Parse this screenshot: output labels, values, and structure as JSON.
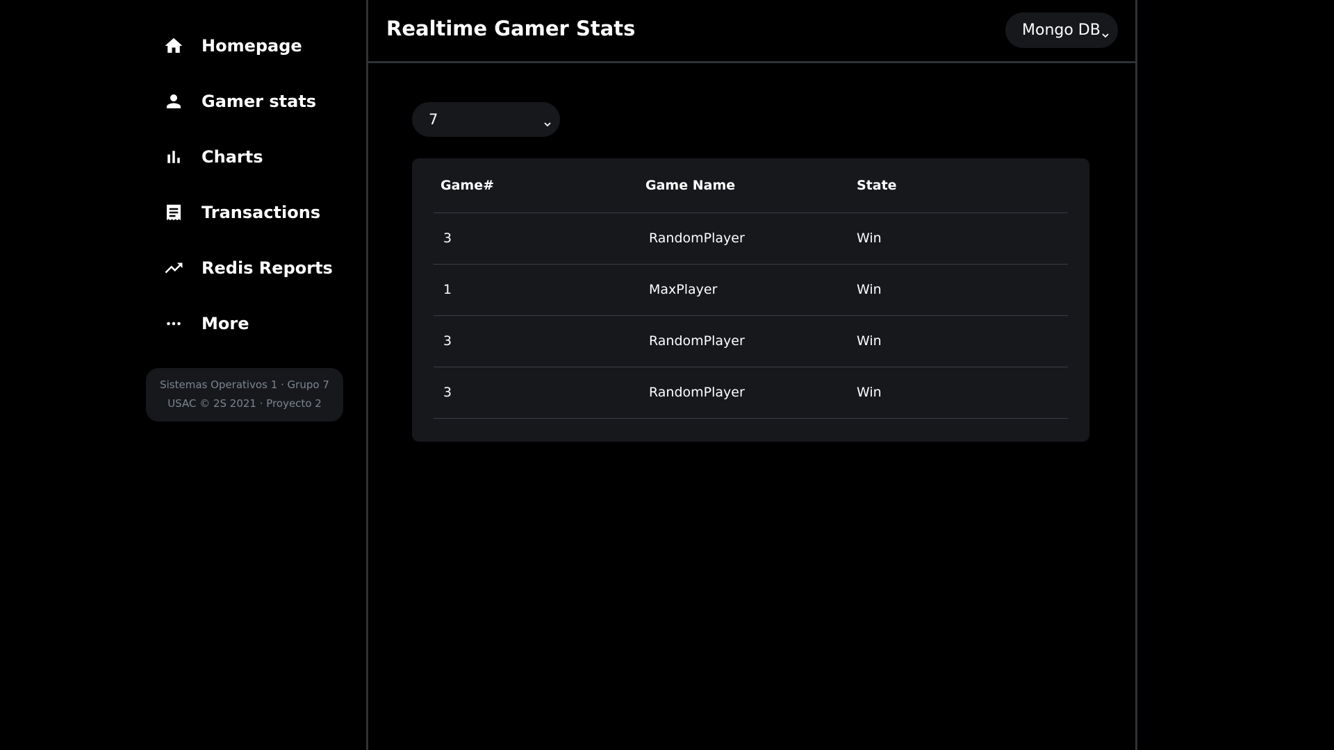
{
  "sidebar": {
    "items": [
      {
        "label": "Homepage",
        "icon": "home-icon"
      },
      {
        "label": "Gamer stats",
        "icon": "person-icon"
      },
      {
        "label": "Charts",
        "icon": "bar-chart-icon"
      },
      {
        "label": "Transactions",
        "icon": "receipt-icon"
      },
      {
        "label": "Redis Reports",
        "icon": "trending-up-icon"
      },
      {
        "label": "More",
        "icon": "more-horizontal-icon"
      }
    ],
    "credits_line1": "Sistemas Operativos 1 · Grupo 7",
    "credits_line2": "USAC © 2S 2021 · Proyecto 2"
  },
  "header": {
    "title": "Realtime Gamer Stats",
    "db_select": "Mongo DB"
  },
  "filter": {
    "game_select": "7"
  },
  "table": {
    "headers": [
      "Game#",
      "Game Name",
      "State"
    ],
    "rows": [
      [
        "3",
        "RandomPlayer",
        "Win"
      ],
      [
        "1",
        "MaxPlayer",
        "Win"
      ],
      [
        "3",
        "RandomPlayer",
        "Win"
      ],
      [
        "3",
        "RandomPlayer",
        "Win"
      ]
    ]
  },
  "colors": {
    "background": "#000000",
    "panel": "#16181c",
    "border": "#2f3336",
    "muted_text": "#7d8590"
  }
}
